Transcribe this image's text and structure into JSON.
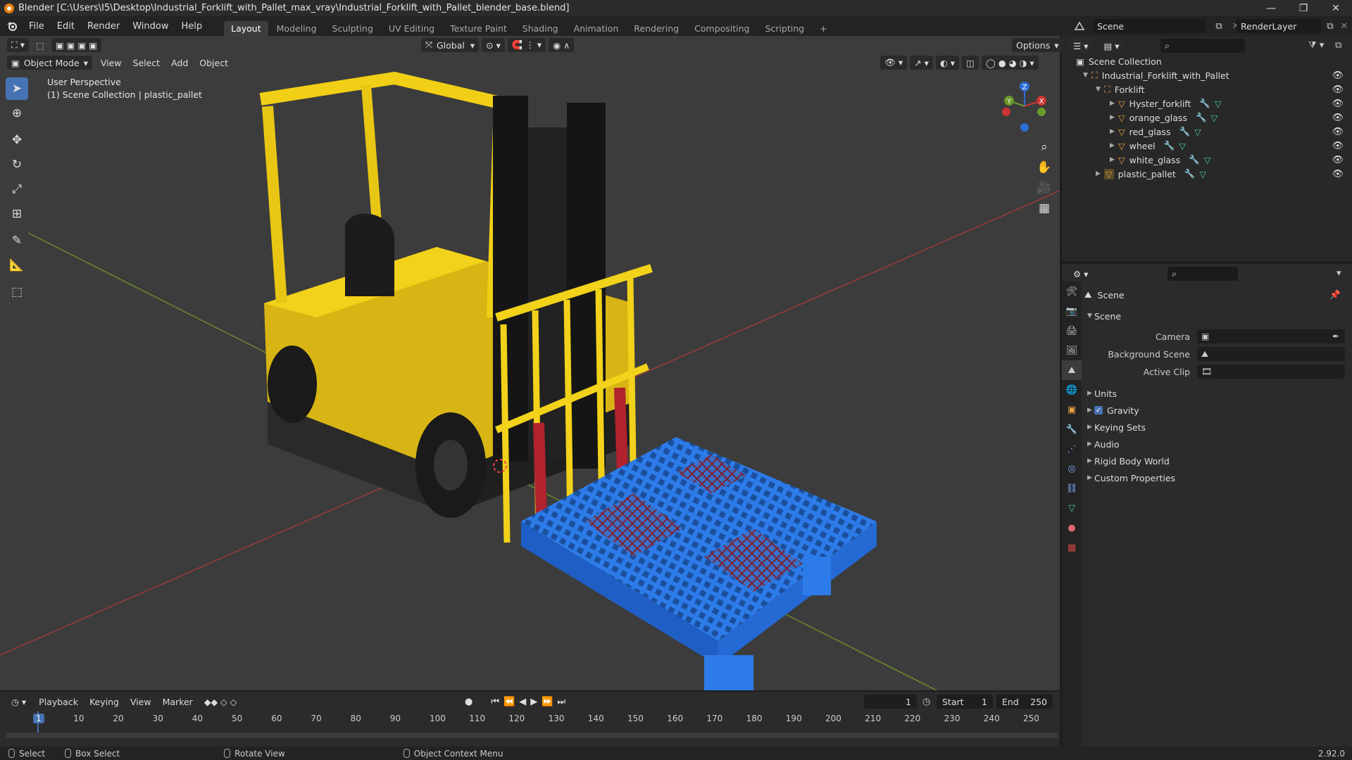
{
  "window": {
    "title": "Blender [C:\\Users\\I5\\Desktop\\Industrial_Forklift_with_Pallet_max_vray\\Industrial_Forklift_with_Pallet_blender_base.blend]",
    "controls": [
      "—",
      "❐",
      "✕"
    ]
  },
  "menu": {
    "items": [
      "File",
      "Edit",
      "Render",
      "Window",
      "Help"
    ],
    "workspaces": [
      "Layout",
      "Modeling",
      "Sculpting",
      "UV Editing",
      "Texture Paint",
      "Shading",
      "Animation",
      "Rendering",
      "Compositing",
      "Scripting"
    ],
    "active_workspace": "Layout",
    "add_tab": "+"
  },
  "top_right": {
    "scene": "Scene",
    "render_layer": "RenderLayer"
  },
  "viewport": {
    "transform_orientation": "Global",
    "options_label": "Options",
    "mode": "Object Mode",
    "menus": [
      "View",
      "Select",
      "Add",
      "Object"
    ],
    "perspective_label": "User Perspective",
    "collection_label": "(1) Scene Collection | plastic_pallet",
    "gizmo": {
      "x": "X",
      "y": "Y",
      "z": "Z"
    }
  },
  "outliner": {
    "root": "Scene Collection",
    "items": [
      {
        "label": "Industrial_Forklift_with_Pallet",
        "depth": 1,
        "type": "collection"
      },
      {
        "label": "Forklift",
        "depth": 2,
        "type": "collection"
      },
      {
        "label": "Hyster_forklift",
        "depth": 3,
        "type": "mesh"
      },
      {
        "label": "orange_glass",
        "depth": 3,
        "type": "mesh"
      },
      {
        "label": "red_glass",
        "depth": 3,
        "type": "mesh"
      },
      {
        "label": "wheel",
        "depth": 3,
        "type": "mesh"
      },
      {
        "label": "white_glass",
        "depth": 3,
        "type": "mesh"
      },
      {
        "label": "plastic_pallet",
        "depth": 2,
        "type": "mesh"
      }
    ]
  },
  "properties": {
    "context_title": "Scene",
    "section": "Scene",
    "fields": [
      {
        "label": "Camera",
        "value": ""
      },
      {
        "label": "Background Scene",
        "value": ""
      },
      {
        "label": "Active Clip",
        "value": ""
      }
    ],
    "panels": [
      "Units",
      "Gravity",
      "Keying Sets",
      "Audio",
      "Rigid Body World",
      "Custom Properties"
    ],
    "gravity_checked": true
  },
  "timeline": {
    "menus": [
      "Playback",
      "Keying",
      "View",
      "Marker"
    ],
    "current_frame": "1",
    "start_label": "Start",
    "start": "1",
    "end_label": "End",
    "end": "250",
    "ruler": [
      "1",
      "10",
      "20",
      "30",
      "40",
      "50",
      "60",
      "70",
      "80",
      "90",
      "100",
      "110",
      "120",
      "130",
      "140",
      "150",
      "160",
      "170",
      "180",
      "190",
      "200",
      "210",
      "220",
      "230",
      "240",
      "250"
    ]
  },
  "status": {
    "select": "Select",
    "box_select": "Box Select",
    "rotate_view": "Rotate View",
    "context_menu": "Object Context Menu",
    "version": "2.92.0"
  },
  "colors": {
    "accent": "#4772b3",
    "forklift_yellow": "#f2d21a",
    "pallet_blue": "#2d7be8",
    "fork_red": "#b0222e",
    "viewport_bg": "#3c3c3c"
  }
}
